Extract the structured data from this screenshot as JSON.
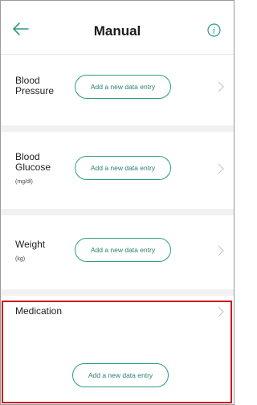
{
  "header": {
    "title": "Manual",
    "back_icon": "back-arrow-icon",
    "info_icon": "info-icon",
    "accent": "#2b9c86"
  },
  "sections": [
    {
      "label": "Blood\nPressure",
      "unit": "",
      "button": "Add a new data entry"
    },
    {
      "label": "Blood\nGlucose",
      "unit": "(mg/dl)",
      "button": "Add a new data entry"
    },
    {
      "label": "Weight",
      "unit": "(kg)",
      "button": "Add a new data entry"
    },
    {
      "label": "Medication",
      "unit": "",
      "button": "Add a new data entry"
    }
  ],
  "highlight_color": "#d0191e"
}
